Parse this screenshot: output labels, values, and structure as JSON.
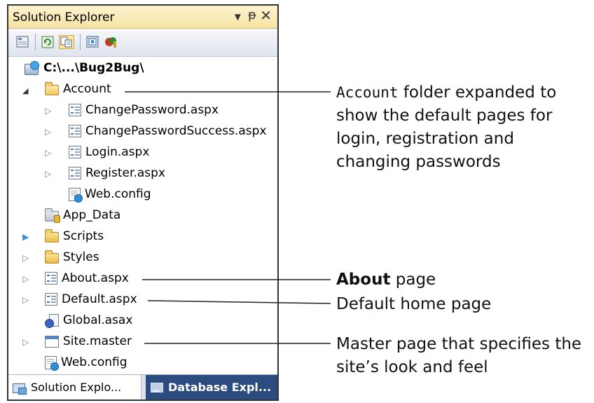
{
  "panel": {
    "title": "Solution Explorer",
    "controls": {
      "dropdown": "▼",
      "pin": "ᵽ",
      "close": "✕"
    }
  },
  "toolbar": {
    "buttons": [
      "properties-icon",
      "refresh-icon",
      "copy-website-icon",
      "view-designer-icon",
      "asp-net-configuration-icon"
    ]
  },
  "tree": {
    "root": {
      "label": "C:\\...\\Bug2Bug\\",
      "icon": "website-project-icon"
    },
    "items": [
      {
        "label": "Account",
        "icon": "folder-open-icon",
        "expanded": true
      },
      {
        "label": "ChangePassword.aspx",
        "icon": "aspx-page-icon"
      },
      {
        "label": "ChangePasswordSuccess.aspx",
        "icon": "aspx-page-icon"
      },
      {
        "label": "Login.aspx",
        "icon": "aspx-page-icon"
      },
      {
        "label": "Register.aspx",
        "icon": "aspx-page-icon"
      },
      {
        "label": "Web.config",
        "icon": "config-file-icon"
      },
      {
        "label": "App_Data",
        "icon": "data-folder-icon"
      },
      {
        "label": "Scripts",
        "icon": "folder-icon"
      },
      {
        "label": "Styles",
        "icon": "folder-icon"
      },
      {
        "label": "About.aspx",
        "icon": "aspx-page-icon"
      },
      {
        "label": "Default.aspx",
        "icon": "aspx-page-icon"
      },
      {
        "label": "Global.asax",
        "icon": "global-asax-icon"
      },
      {
        "label": "Site.master",
        "icon": "master-page-icon"
      },
      {
        "label": "Web.config",
        "icon": "config-file-icon"
      }
    ]
  },
  "tabs": [
    {
      "label": "Solution Explo...",
      "active": true
    },
    {
      "label": "Database Expl...",
      "active": false
    }
  ],
  "annotations": {
    "account": {
      "code": "Account",
      "line1_rest": " folder expanded to",
      "line2": "show the default pages for",
      "line3": "login, registration and",
      "line4": "changing passwords"
    },
    "about": {
      "bold": "About",
      "rest": " page"
    },
    "default": {
      "text": "Default home page"
    },
    "master": {
      "line1": "Master page that specifies the",
      "line2": "site’s look and feel"
    }
  },
  "colors": {
    "title_bar": "#f6e3a2",
    "inactive_tab": "#2c4b7e",
    "expander_blue": "#3b8fd9"
  }
}
